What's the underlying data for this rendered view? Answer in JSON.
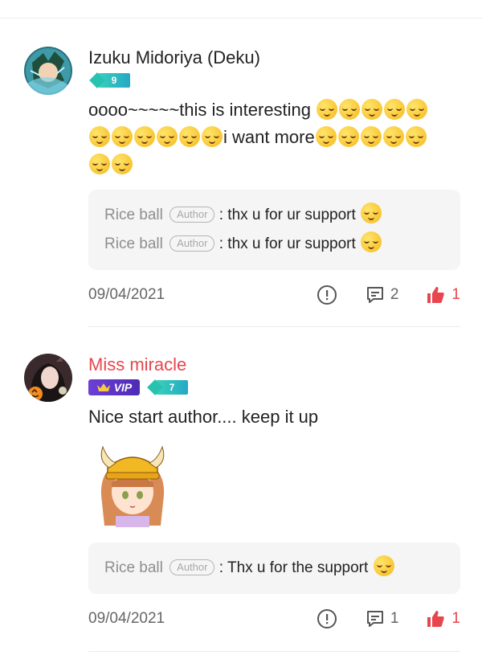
{
  "comments": [
    {
      "username": "Izuku Midoriya (Deku)",
      "level": "9",
      "text_line1": "oooo~~~~~this is interesting",
      "text_line2": "i want more",
      "replies": [
        {
          "name": "Rice ball",
          "tag": "Author",
          "text": ": thx u for ur support"
        },
        {
          "name": "Rice ball",
          "tag": "Author",
          "text": ": thx u for ur support"
        }
      ],
      "date": "09/04/2021",
      "comment_count": "2",
      "like_count": "1"
    },
    {
      "username": "Miss miracle",
      "vip": "VIP",
      "level": "7",
      "text": "Nice start author.... keep it up",
      "sticker": "viking-girl-sticker",
      "replies": [
        {
          "name": "Rice ball",
          "tag": "Author",
          "text": ": Thx u for the support"
        }
      ],
      "date": "09/04/2021",
      "comment_count": "1",
      "like_count": "1"
    }
  ],
  "icons": {
    "report": "exclamation-circle-icon",
    "comment": "comment-bubble-icon",
    "like": "thumbs-up-icon",
    "emoji": "relieved-face-emoji"
  },
  "colors": {
    "accent_red": "#e8464e",
    "level_teal": "#27c2b0",
    "vip_purple": "#5b34c4",
    "reply_bg": "#f5f5f5"
  }
}
